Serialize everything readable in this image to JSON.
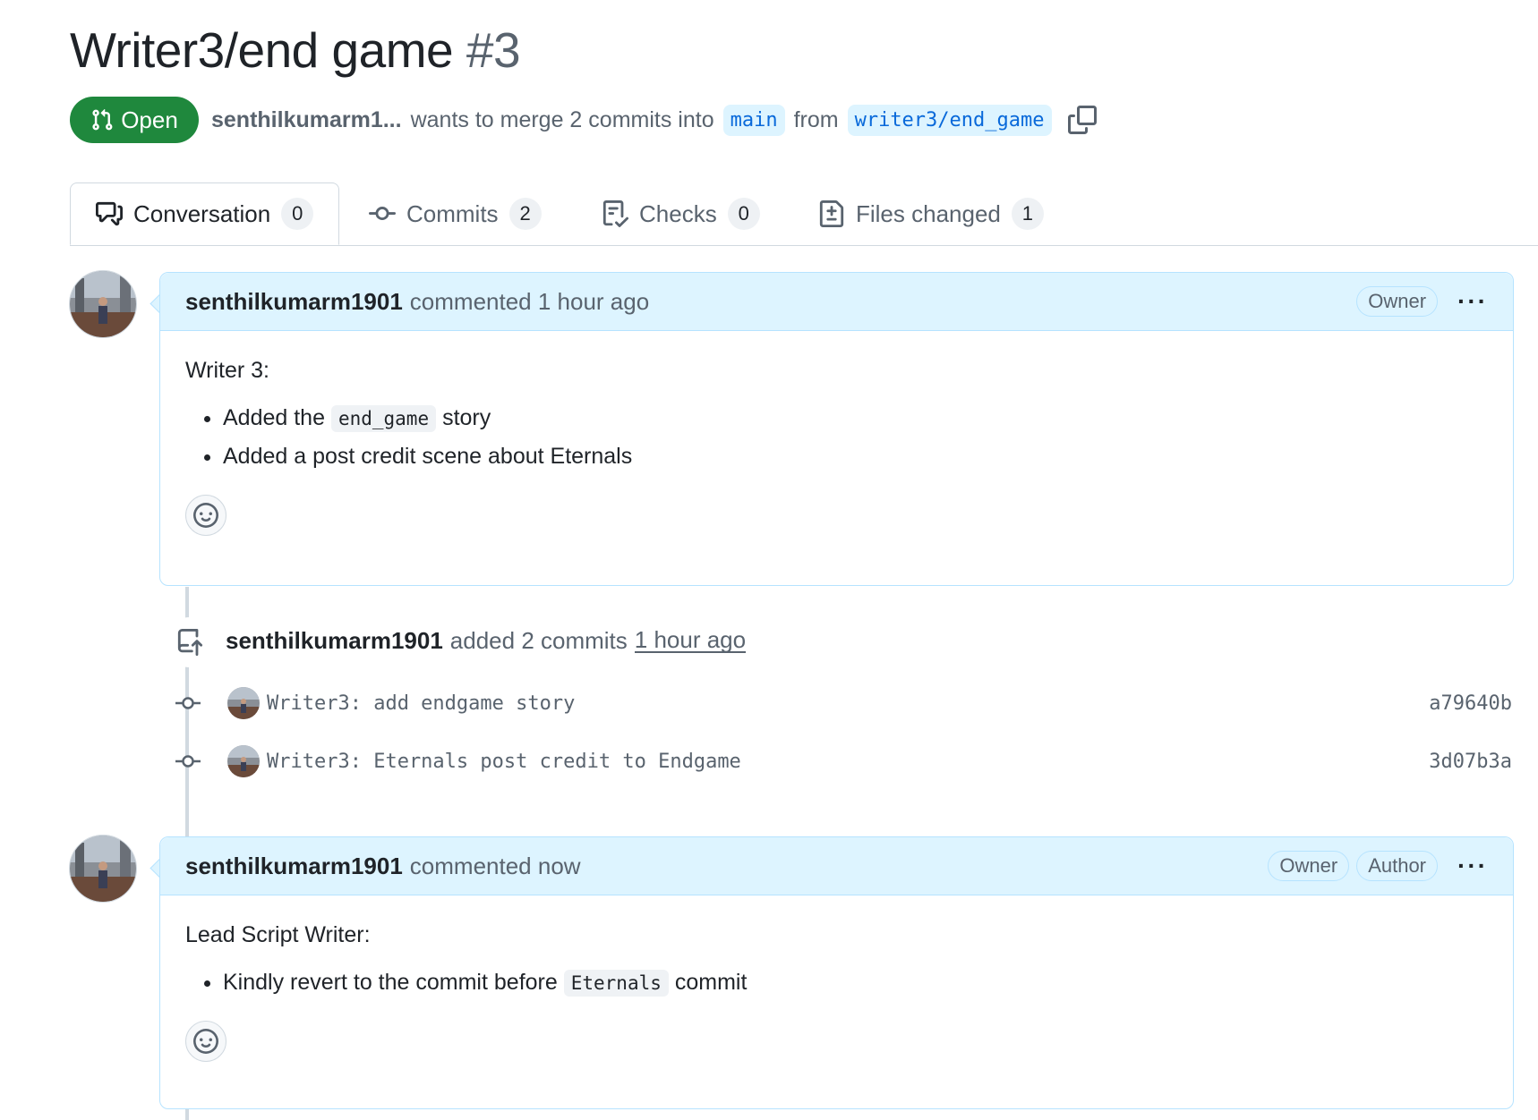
{
  "header": {
    "title": "Writer3/end game",
    "number": "#3",
    "status": "Open",
    "author": "senthilkumarm1...",
    "merge_text": "wants to merge 2 commits into",
    "base_branch": "main",
    "from_text": "from",
    "head_branch": "writer3/end_game"
  },
  "tabs": [
    {
      "label": "Conversation",
      "count": "0",
      "icon": "comment-discussion-icon"
    },
    {
      "label": "Commits",
      "count": "2",
      "icon": "git-commit-icon"
    },
    {
      "label": "Checks",
      "count": "0",
      "icon": "checklist-icon"
    },
    {
      "label": "Files changed",
      "count": "1",
      "icon": "file-diff-icon"
    }
  ],
  "comment1": {
    "author": "senthilkumarm1901",
    "action": "commented 1 hour ago",
    "roles": [
      "Owner"
    ],
    "heading": "Writer 3:",
    "bullet1_pre": "Added the",
    "bullet1_code": "end_game",
    "bullet1_post": "story",
    "bullet2": "Added a post credit scene about Eternals"
  },
  "event": {
    "author": "senthilkumarm1901",
    "action": "added 2 commits",
    "when": "1 hour ago"
  },
  "commits": [
    {
      "message": "Writer3: add endgame story",
      "sha": "a79640b"
    },
    {
      "message": "Writer3: Eternals post credit to Endgame",
      "sha": "3d07b3a"
    }
  ],
  "comment2": {
    "author": "senthilkumarm1901",
    "action": "commented now",
    "roles": [
      "Owner",
      "Author"
    ],
    "heading": "Lead Script Writer:",
    "bullet1_pre": "Kindly revert to the commit before",
    "bullet1_code": "Eternals",
    "bullet1_post": "commit"
  },
  "colors": {
    "open_green": "#1f883d",
    "link_blue": "#0969da",
    "header_bg": "#ddf4ff"
  }
}
